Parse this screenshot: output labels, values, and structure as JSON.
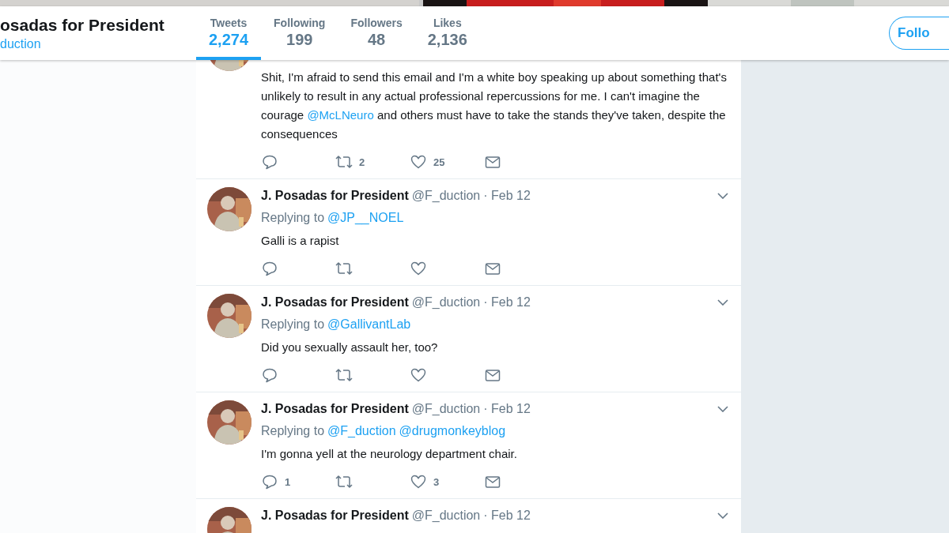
{
  "profile": {
    "name": "osadas for President",
    "handle": "duction"
  },
  "stats": [
    {
      "label": "Tweets",
      "value": "2,274",
      "selected": true
    },
    {
      "label": "Following",
      "value": "199",
      "selected": false
    },
    {
      "label": "Followers",
      "value": "48",
      "selected": false
    },
    {
      "label": "Likes",
      "value": "2,136",
      "selected": false
    }
  ],
  "follow_button": "Follo",
  "tweets": [
    {
      "kind": "cut",
      "text": "Shit, I'm afraid to send this email and I'm a white boy speaking up about something that's unlikely to result in any actual professional repercussions for me. I can't imagine the courage **@McLNeuro** and others must have to take the stands they've taken, despite the consequences",
      "retweets": "2",
      "likes": "25"
    },
    {
      "kind": "full",
      "name": "J. Posadas for President",
      "handle": "@F_duction",
      "date": "· Feb 12",
      "replying_label": "Replying to",
      "replying_to": [
        "@JP__NOEL"
      ],
      "text": "Galli is a rapist"
    },
    {
      "kind": "full",
      "name": "J. Posadas for President",
      "handle": "@F_duction",
      "date": "· Feb 12",
      "replying_label": "Replying to",
      "replying_to": [
        "@GallivantLab"
      ],
      "text": "Did you sexually assault her, too?"
    },
    {
      "kind": "full",
      "name": "J. Posadas for President",
      "handle": "@F_duction",
      "date": "· Feb 12",
      "replying_label": "Replying to",
      "replying_to": [
        "@F_duction",
        "@drugmonkeyblog"
      ],
      "text": "I'm gonna yell at the neurology department chair.",
      "replies": "1",
      "likes": "3"
    },
    {
      "kind": "head",
      "name": "J. Posadas for President",
      "handle": "@F_duction",
      "date": "· Feb 12"
    }
  ]
}
